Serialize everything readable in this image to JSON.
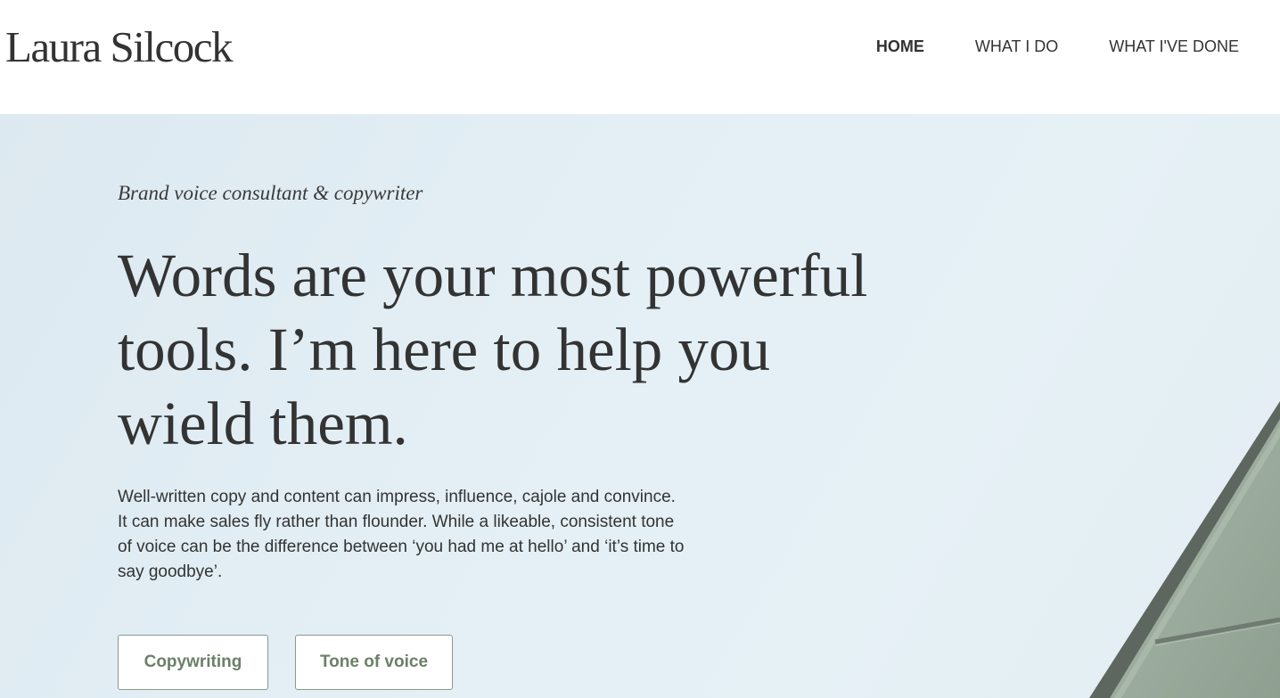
{
  "header": {
    "logo": "Laura Silcock",
    "nav": [
      {
        "label": "HOME",
        "active": true
      },
      {
        "label": "WHAT I DO",
        "active": false
      },
      {
        "label": "WHAT I'VE DONE",
        "active": false
      }
    ]
  },
  "hero": {
    "eyebrow": "Brand voice consultant & copywriter",
    "headline": "Words are your most powerful tools. I’m here to help you wield them.",
    "body": "Well-written copy and content can impress, influence, cajole and convince. It can make sales fly rather than flounder. While a likeable, consistent tone of voice can be the difference between ‘you had me at hello’ and ‘it’s time to say goodbye’.",
    "buttons": [
      {
        "label": "Copywriting"
      },
      {
        "label": "Tone of voice"
      }
    ]
  },
  "colors": {
    "text": "#333333",
    "accent_green": "#6b8068",
    "sky": "#e3eff5"
  }
}
